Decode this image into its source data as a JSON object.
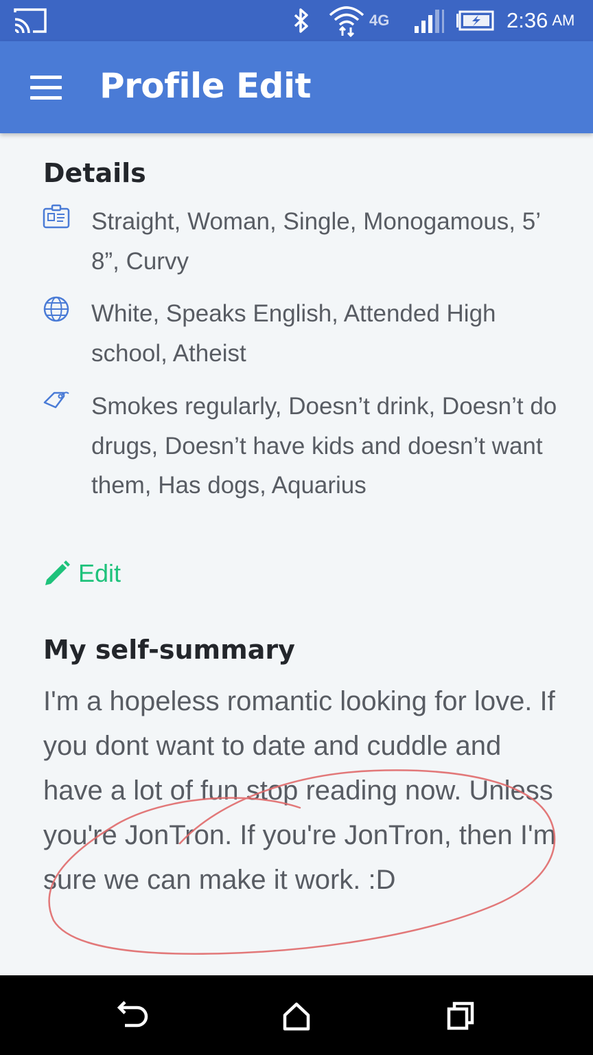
{
  "status_bar": {
    "time": "2:36",
    "ampm": "AM",
    "network_label": "4G",
    "icons": [
      "cast-icon",
      "bluetooth-icon",
      "wifi-icon",
      "signal-icon",
      "battery-charging-icon"
    ]
  },
  "app_bar": {
    "title": "Profile Edit",
    "menu_icon": "hamburger-menu-icon"
  },
  "details": {
    "heading": "Details",
    "rows": [
      {
        "icon": "id-card-icon",
        "text": "Straight, Woman, Single, Monogamous, 5’ 8”, Curvy"
      },
      {
        "icon": "globe-icon",
        "text": "White, Speaks English, Attended High school, Atheist"
      },
      {
        "icon": "tag-icon",
        "text": "Smokes regularly, Doesn’t drink, Doesn’t do drugs, Doesn’t have kids and doesn’t want them, Has dogs, Aquarius"
      }
    ],
    "edit_label": "Edit"
  },
  "self_summary": {
    "heading": "My self-summary",
    "text": "I'm a hopeless romantic looking for love. If you dont want to date and cuddle and have a lot of fun stop reading now. Unless you're JonTron. If you're JonTron, then I'm sure we can make it work. :D"
  },
  "nav_bar": {
    "buttons": [
      "back-icon",
      "home-icon",
      "recent-apps-icon"
    ]
  },
  "colors": {
    "status_bar": "#3c66c4",
    "app_bar": "#4a7bd6",
    "accent_green": "#1ec27b",
    "icon_blue": "#4a7bd6",
    "annotation_red": "#e06a6a",
    "background": "#f3f6f8"
  }
}
